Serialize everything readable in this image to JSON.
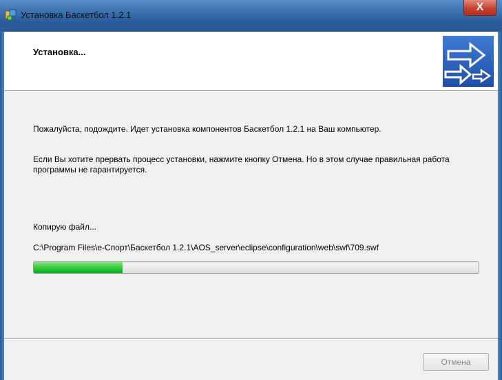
{
  "window": {
    "title": "Установка Баскетбол 1.2.1",
    "close_glyph": "X"
  },
  "header": {
    "title": "Установка..."
  },
  "body": {
    "line1": "Пожалуйста, подождите. Идет установка компонентов Баскетбол 1.2.1 на Ваш компьютер.",
    "line2": "Если Вы хотите прервать процесс установки, нажмите кнопку Отмена. Но в этом случае правильная работа программы не гарантируется.",
    "status_label": "Копирую файл...",
    "file_path": "C:\\Program Files\\е-Спорт\\Баскетбол 1.2.1\\AOS_server\\eclipse\\configuration\\web\\swf\\709.swf"
  },
  "progress": {
    "fraction": 0.2
  },
  "buttons": {
    "cancel_label": "Отмена"
  },
  "colors": {
    "progress_fill": "#06b025",
    "disabled_text": "#8a8a8a"
  }
}
